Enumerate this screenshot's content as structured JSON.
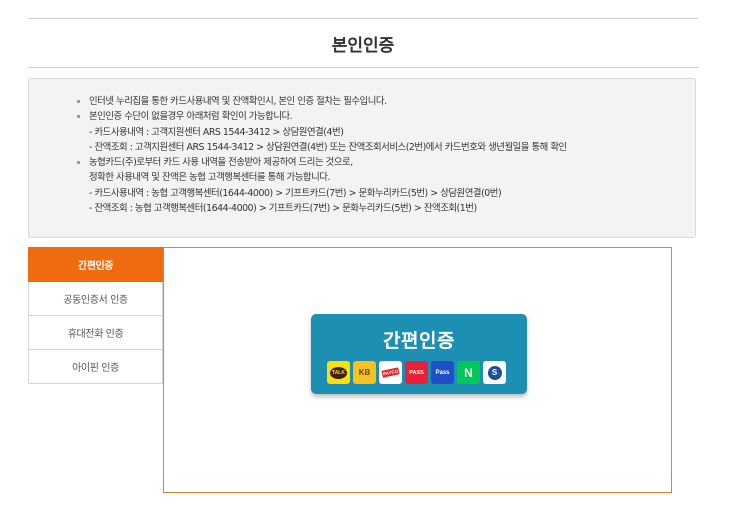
{
  "header": {
    "title": "본인인증"
  },
  "notice": {
    "lines": [
      "인터넷 누리집을 통한 카드사용내역 및 잔액확인시, 본인 인증 절차는 필수입니다.",
      "본인인증 수단이 없을경우 아래처럼 확인이 가능합니다.",
      "- 카드사용내역 : 고객지원센터 ARS 1544-3412 > 상담원연결(4번)",
      "- 잔액조회 : 고객지원센터 ARS 1544-3412 > 상담원연결(4번) 또는 잔액조회서비스(2번)에서 카드번호와 생년월일을 통해 확인",
      "농협카드(주)로부터 카드 사용 내역을 전송받아 제공하여 드리는 것으로,",
      "정확한 사용내역 및 잔액은 농협 고객행복센터를 통해 가능합니다.",
      "- 카드사용내역 : 농협 고객행복센터(1644-4000) > 기프트카드(7번) > 문화누리카드(5번) > 상담원연결(0번)",
      "- 잔액조회 : 농협 고객행복센터(1644-4000) > 기프트카드(7번) > 문화누리카드(5번) > 잔액조회(1번)"
    ]
  },
  "tabs": [
    {
      "label": "간편인증"
    },
    {
      "label": "공동인증서 인증"
    },
    {
      "label": "휴대전화 인증"
    },
    {
      "label": "아이핀 인증"
    }
  ],
  "auth": {
    "title": "간편인증",
    "providers": [
      {
        "name": "kakao-icon",
        "label": "TALK"
      },
      {
        "name": "kb-icon",
        "label": "KB"
      },
      {
        "name": "payco-icon",
        "label": "PAYCO"
      },
      {
        "name": "pass-icon",
        "label": "PASS"
      },
      {
        "name": "samsung-pass-icon",
        "label": "Pass"
      },
      {
        "name": "naver-icon",
        "label": "N"
      },
      {
        "name": "shinhan-icon",
        "label": "S"
      }
    ]
  },
  "colors": {
    "active_tab": "#f06a0f",
    "panel_border": "#d8892b",
    "auth_button": "#1d8fb3"
  }
}
